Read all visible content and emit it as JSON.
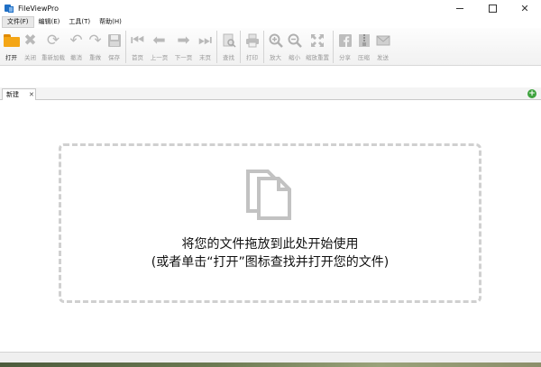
{
  "window": {
    "title": "FileViewPro",
    "controls": {
      "minimize": "—",
      "maximize": "☐",
      "close": "✕"
    }
  },
  "menu": [
    {
      "label": "文件(F)"
    },
    {
      "label": "编辑(E)"
    },
    {
      "label": "工具(T)"
    },
    {
      "label": "帮助(H)"
    }
  ],
  "toolbar": {
    "open": "打开",
    "close": "关闭",
    "reload": "重新加载",
    "undo": "撤消",
    "redo": "重做",
    "save": "保存",
    "first": "首页",
    "prev": "上一页",
    "next": "下一页",
    "last": "末页",
    "find": "查找",
    "print": "打印",
    "zoom_in": "放大",
    "zoom_out": "缩小",
    "zoom_reset": "缩放重置",
    "share": "分享",
    "compress": "压缩",
    "send": "发送"
  },
  "tabs": {
    "active_label": "新建",
    "close_glyph": "✕",
    "add_glyph": "+"
  },
  "dropzone": {
    "line1": "将您的文件拖放到此处开始使用",
    "line2": "(或者单击“打开”图标查找并打开您的文件)"
  },
  "icons": {
    "folder": "folder-icon",
    "close": "x-icon",
    "reload": "refresh-icon",
    "undo": "undo-arrow-icon",
    "redo": "redo-arrow-icon",
    "save": "floppy-disk-icon",
    "first": "first-page-icon",
    "prev": "left-arrow-icon",
    "next": "right-arrow-icon",
    "last": "last-page-icon",
    "find": "find-document-icon",
    "print": "printer-icon",
    "zoom_in": "zoom-in-icon",
    "zoom_out": "zoom-out-icon",
    "zoom_reset": "fit-arrows-icon",
    "share": "facebook-icon",
    "compress": "zip-icon",
    "send": "envelope-icon"
  },
  "colors": {
    "accent": "#f4a616",
    "disabled_icon": "#b9b9b9",
    "add_tab": "#3fa33f",
    "dropzone_border": "#d0d0d0"
  }
}
